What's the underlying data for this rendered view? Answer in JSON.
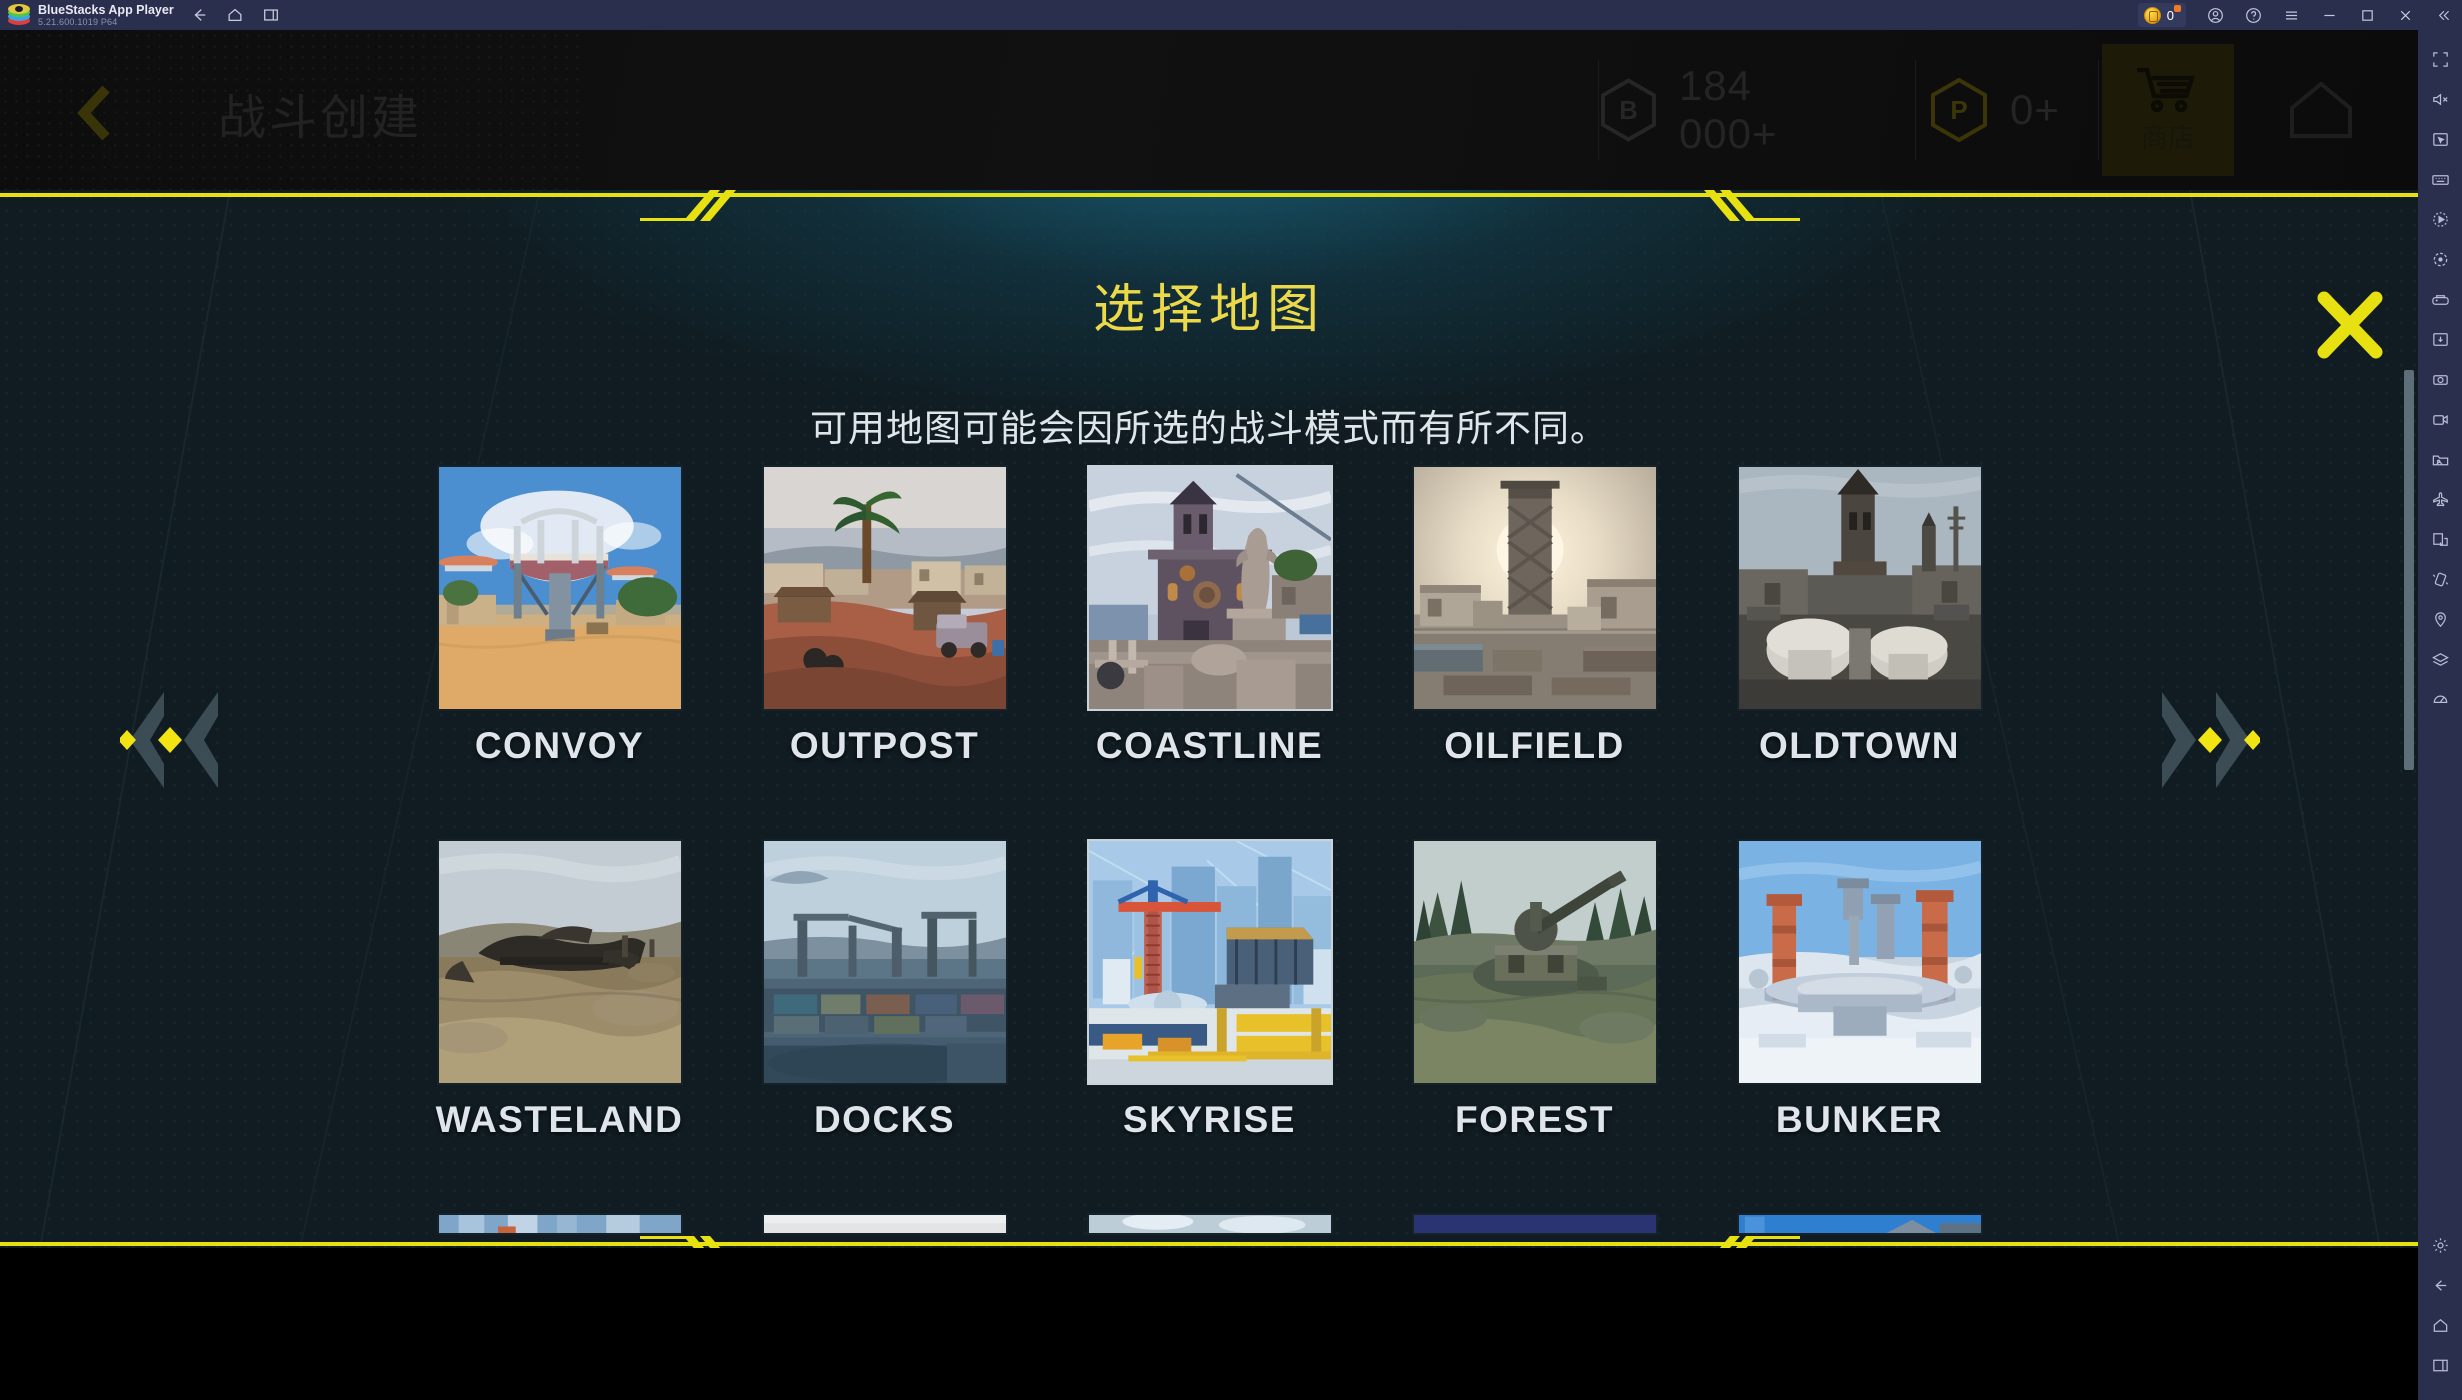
{
  "window": {
    "app_title": "BlueStacks App Player",
    "app_version": "5.21.600.1019 P64",
    "nav_icons": [
      "back-icon",
      "home-icon",
      "recents-icon"
    ],
    "coin_value": "0",
    "right_icons": [
      "account-icon",
      "help-icon",
      "menu-icon",
      "minimize-icon",
      "maximize-icon",
      "close-icon",
      "collapse-icon"
    ]
  },
  "game_header": {
    "back_label": "back-chevron",
    "title": "战斗创建",
    "currency": [
      {
        "icon": "hex-b-icon",
        "value": "184 000+"
      },
      {
        "icon": "hex-p-icon",
        "value": "0+"
      }
    ],
    "shop_label": "商店",
    "home_icon": "home-icon"
  },
  "modal": {
    "title": "选择地图",
    "subtitle": "可用地图可能会因所选的战斗模式而有所不同。",
    "close_icon": "close-x-icon",
    "nav_left_icon": "chevron-left-double",
    "nav_right_icon": "chevron-right-double",
    "maps": [
      [
        {
          "label": "CONVOY",
          "selected": false,
          "sky": "#4b8fd1",
          "ground": "#dfa967",
          "accent": "#c9c3b8"
        },
        {
          "label": "OUTPOST",
          "selected": false,
          "sky": "#c6cbd6",
          "ground": "#a85f45",
          "accent": "#8d6a4f"
        },
        {
          "label": "COASTLINE",
          "selected": true,
          "sky": "#bcc8d6",
          "ground": "#6e6272",
          "accent": "#8d8190"
        },
        {
          "label": "OILFIELD",
          "selected": false,
          "sky": "#d8d2c2",
          "ground": "#7d756a",
          "accent": "#b8a78c"
        },
        {
          "label": "OLDTOWN",
          "selected": false,
          "sky": "#9aa8b4",
          "ground": "#5c5a55",
          "accent": "#7e7a70"
        }
      ],
      [
        {
          "label": "WASTELAND",
          "selected": false,
          "sky": "#b9c4cc",
          "ground": "#8a7a5c",
          "accent": "#5c564a"
        },
        {
          "label": "DOCKS",
          "selected": false,
          "sky": "#aec3d2",
          "ground": "#4d6576",
          "accent": "#7e8c96"
        },
        {
          "label": "SKYRISE",
          "selected": true,
          "sky": "#a8cae8",
          "ground": "#6d8aa8",
          "accent": "#e8c02a"
        },
        {
          "label": "FOREST",
          "selected": false,
          "sky": "#b8c6c4",
          "ground": "#5c6a58",
          "accent": "#47533f"
        },
        {
          "label": "BUNKER",
          "selected": false,
          "sky": "#6aa8e0",
          "ground": "#c8d4e0",
          "accent": "#d88a6a"
        }
      ],
      [
        {
          "label": "",
          "selected": false,
          "sky": "#7fa6c8",
          "ground": "#7fa6c8",
          "accent": "#7fa6c8"
        },
        {
          "label": "",
          "selected": false,
          "sky": "#e2e4e6",
          "ground": "#e2e4e6",
          "accent": "#e2e4e6"
        },
        {
          "label": "",
          "selected": false,
          "sky": "#bdcdd8",
          "ground": "#bdcdd8",
          "accent": "#bdcdd8"
        },
        {
          "label": "",
          "selected": false,
          "sky": "#2b3472",
          "ground": "#2b3472",
          "accent": "#2b3472"
        },
        {
          "label": "",
          "selected": false,
          "sky": "#2f7fd0",
          "ground": "#2f7fd0",
          "accent": "#2f7fd0"
        }
      ]
    ]
  },
  "sidebar": {
    "tools": [
      "fullscreen-icon",
      "mute-icon",
      "cursor-icon",
      "keyboard-icon",
      "macro-icon",
      "rotate-icon",
      "gamepad-icon",
      "install-apk-icon",
      "screenshot-icon",
      "record-icon",
      "media-manager-icon",
      "airplane-icon",
      "multi-instance-icon",
      "shake-icon",
      "location-icon",
      "layers-icon",
      "eco-mode-icon"
    ],
    "bottom": [
      "settings-gear-icon",
      "back-arrow-icon",
      "home-icon",
      "recents-icon"
    ]
  },
  "colors": {
    "accent_yellow": "#e8e112",
    "title_yellow": "#ecd94a",
    "modal_bg": "#101c21",
    "chrome_bg": "#2a2f4e"
  }
}
